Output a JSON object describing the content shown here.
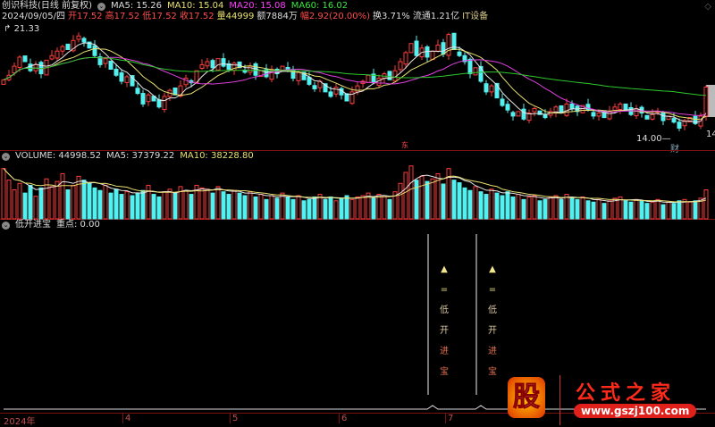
{
  "header": {
    "title": "创识科技(日线 前复权)",
    "ma5": "MA5: 15.26",
    "ma10": "MA10: 15.04",
    "ma20": "MA20: 15.08",
    "ma60": "MA60: 16.02"
  },
  "quote": {
    "date": "2024/09/05/四",
    "open": "开17.52",
    "high": "高17.52",
    "low": "低17.52",
    "close": "收17.52",
    "vol": "量44999",
    "amount": "额7884万",
    "change": "幅2.92(20.00%)",
    "turnover": "换3.71%",
    "float": "流通1.21亿",
    "industry": "IT设备"
  },
  "price_labels": {
    "max": "21.33",
    "min": "14.00",
    "right": "14",
    "fin_marker": "财",
    "event_marker": "东"
  },
  "volume_header": {
    "volume": "VOLUME: 44998.52",
    "ma5": "MA5: 37379.22",
    "ma10": "MA10: 38228.80"
  },
  "indicator_header": {
    "name": "低开进宝",
    "value": "重点: 0.00"
  },
  "signals": [
    {
      "bar": 80,
      "chars": [
        "▲",
        "=",
        "低",
        "开",
        "进",
        "宝"
      ]
    },
    {
      "bar": 89,
      "chars": [
        "▲",
        "=",
        "低",
        "开",
        "进",
        "宝"
      ]
    }
  ],
  "xaxis": [
    "2024年",
    "4",
    "5",
    "6",
    "7"
  ],
  "logo": {
    "glyph": "股",
    "name": "公式之家",
    "url": "www.gszj100.com"
  },
  "colors": {
    "up": "#ff3c3c",
    "down": "#54f0f0",
    "ma5": "#e6e6e6",
    "ma10": "#e8e070",
    "ma20": "#e040e0",
    "ma60": "#2ec82e"
  },
  "chart_data": {
    "type": "candlestick",
    "ylim": [
      14.0,
      21.33
    ],
    "closes": [
      18.0,
      18.3,
      18.9,
      19.5,
      19.2,
      18.6,
      19.0,
      18.4,
      19.3,
      19.6,
      19.9,
      20.2,
      20.0,
      20.6,
      20.9,
      20.5,
      20.1,
      19.6,
      19.0,
      19.4,
      18.7,
      18.3,
      17.9,
      18.2,
      17.6,
      17.1,
      16.4,
      17.0,
      16.6,
      16.2,
      16.9,
      17.3,
      17.0,
      17.6,
      18.1,
      17.8,
      18.6,
      19.0,
      19.2,
      18.8,
      19.4,
      18.9,
      18.7,
      19.1,
      18.8,
      18.5,
      18.9,
      18.3,
      18.6,
      18.2,
      18.7,
      18.4,
      18.9,
      18.6,
      18.1,
      18.5,
      18.0,
      17.7,
      17.4,
      17.9,
      17.2,
      16.9,
      17.5,
      17.0,
      16.6,
      17.2,
      17.6,
      17.9,
      18.3,
      17.8,
      18.1,
      18.4,
      18.0,
      18.6,
      19.2,
      19.8,
      20.4,
      19.6,
      20.1,
      19.5,
      19.9,
      20.3,
      19.7,
      21.0,
      20.0,
      19.6,
      19.2,
      18.4,
      18.8,
      17.9,
      17.2,
      17.6,
      16.8,
      16.3,
      16.0,
      15.6,
      15.9,
      15.4,
      15.8,
      16.1,
      15.7,
      15.5,
      15.9,
      16.2,
      15.8,
      16.4,
      16.1,
      15.9,
      16.3,
      16.0,
      15.6,
      15.8,
      15.5,
      15.9,
      16.2,
      16.4,
      16.0,
      15.7,
      16.1,
      15.8,
      15.4,
      15.7,
      15.9,
      15.3,
      15.6,
      15.2,
      14.8,
      15.3,
      15.5,
      15.1,
      15.6,
      17.52
    ],
    "volumes": [
      78000,
      60000,
      45000,
      55000,
      40000,
      52000,
      35000,
      48000,
      62000,
      50000,
      58000,
      70000,
      45000,
      52000,
      66000,
      60000,
      55000,
      48000,
      44000,
      52000,
      40000,
      46000,
      38000,
      42000,
      36000,
      40000,
      44000,
      52000,
      38000,
      34000,
      42000,
      46000,
      40000,
      50000,
      44000,
      38000,
      52000,
      48000,
      46000,
      40000,
      50000,
      42000,
      38000,
      44000,
      40000,
      36000,
      42000,
      34000,
      38000,
      30000,
      36000,
      32000,
      40000,
      34000,
      30000,
      36000,
      28000,
      30000,
      34000,
      38000,
      30000,
      34000,
      28000,
      32000,
      36000,
      30000,
      34000,
      36000,
      40000,
      32000,
      38000,
      36000,
      30000,
      42000,
      55000,
      72000,
      82000,
      60000,
      66000,
      58000,
      62000,
      70000,
      54000,
      78000,
      60000,
      56000,
      48000,
      44000,
      50000,
      42000,
      38000,
      46000,
      40000,
      36000,
      42000,
      34000,
      38000,
      30000,
      34000,
      36000,
      28000,
      30000,
      34000,
      36000,
      30000,
      38000,
      32000,
      30000,
      34000,
      28000,
      26000,
      30000,
      24000,
      28000,
      32000,
      34000,
      28000,
      26000,
      30000,
      28000,
      24000,
      26000,
      30000,
      22000,
      26000,
      24000,
      28000,
      30000,
      26000,
      28000,
      32000,
      44999
    ],
    "vol_max": 90000
  }
}
